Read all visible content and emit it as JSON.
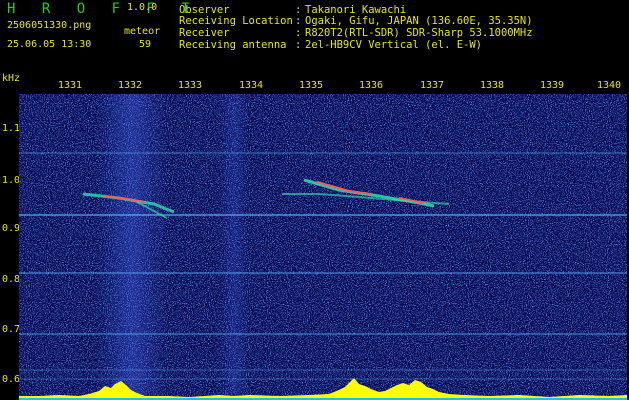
{
  "header": {
    "app_title": "H R O F F T",
    "app_version": "1.0.0",
    "file_name": "2506051330.png",
    "datetime": "25.06.05 13:30",
    "meteor_label": "meteor",
    "meteor_count": "59",
    "info": [
      {
        "label": "Observer",
        "value": "Takanori Kawachi"
      },
      {
        "label": "Receiving Location",
        "value": "Ogaki, Gifu, JAPAN (136.60E, 35.35N)"
      },
      {
        "label": "Receiver",
        "value": "R820T2(RTL-SDR) SDR-Sharp 53.1000MHz"
      },
      {
        "label": "Receiving antenna",
        "value": "2el-HB9CV Vertical (el. E-W)"
      }
    ],
    "separator": ":"
  },
  "axes": {
    "y_unit": "kHz",
    "x_ticks": [
      "1331",
      "1332",
      "1333",
      "1334",
      "1335",
      "1336",
      "1337",
      "1338",
      "1339",
      "1340"
    ],
    "y_ticks": [
      "1.1",
      "1.0",
      "0.9",
      "0.8",
      "0.7",
      "0.6"
    ]
  },
  "colors": {
    "background": "#000000",
    "label_text": "#e8e800",
    "title_text": "#19d219",
    "noise_floor": "#08084f",
    "carrier_line": "#5fb6ff",
    "echo_trace": "#ff5a5a",
    "echo_glow": "#38e8b0",
    "power_bars": "#ffff00",
    "baseline": "#00c8ff"
  }
}
